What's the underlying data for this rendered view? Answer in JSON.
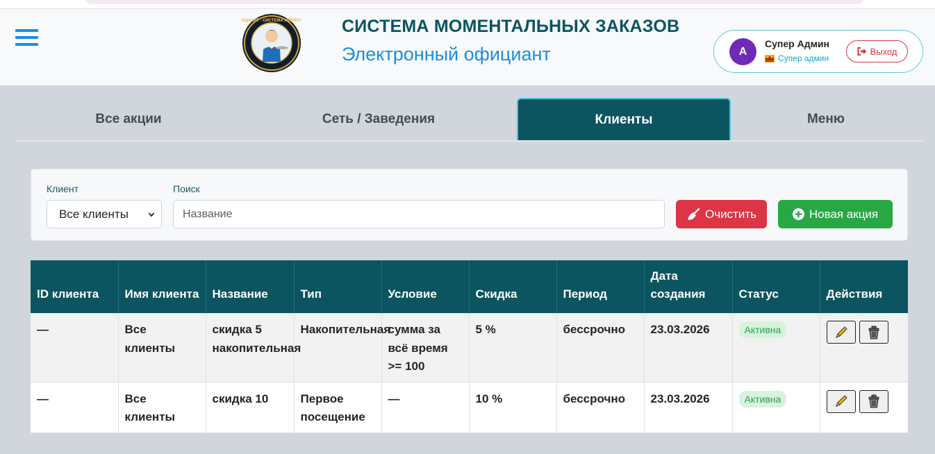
{
  "colors": {
    "primary": "#0b5460",
    "accent": "#1b8ee0",
    "danger": "#dc3545",
    "success": "#27a844",
    "avatar": "#6f2bb8"
  },
  "header": {
    "menu_icon": "hamburger-icon",
    "logo_icon": "waiter-logo",
    "logo_text": "ЭЛЕКТРОННЫЙ ОФИЦИАНТ · СИСТЕМА МОМЕНТАЛЬНЫХ ЗАКАЗОВ",
    "title": "СИСТЕМА МОМЕНТАЛЬНЫХ ЗАКАЗОВ",
    "subtitle": "Электронный официант"
  },
  "user": {
    "avatar_letter": "A",
    "name": "Супер Админ",
    "role_icon": "crown-icon",
    "role": "Супер админ",
    "logout_icon": "sign-out-icon",
    "logout_label": "Выход"
  },
  "tabs": [
    {
      "label": "Все акции",
      "active": false
    },
    {
      "label": "Сеть / Заведения",
      "active": false
    },
    {
      "label": "Клиенты",
      "active": true
    },
    {
      "label": "Меню",
      "active": false
    }
  ],
  "filters": {
    "client_label": "Клиент",
    "client_value": "Все клиенты",
    "search_label": "Поиск",
    "search_placeholder": "Название",
    "clear_icon": "broom-icon",
    "clear_label": "Очистить",
    "new_icon": "plus-circle-icon",
    "new_label": "Новая акция"
  },
  "table": {
    "columns": [
      "ID клиента",
      "Имя клиента",
      "Название",
      "Тип",
      "Условие",
      "Скидка",
      "Период",
      "Дата создания",
      "Статус",
      "Действия"
    ],
    "rows": [
      {
        "id": "—",
        "client": "Все клиенты",
        "name": "скидка 5 накопительная",
        "type": "Накопительная",
        "condition": "сумма за всё время >= 100",
        "discount": "5 %",
        "period": "бессрочно",
        "created": "23.03.2026",
        "status": "Активна"
      },
      {
        "id": "—",
        "client": "Все клиенты",
        "name": "скидка 10",
        "type": "Первое посещение",
        "condition": "—",
        "discount": "10 %",
        "period": "бессрочно",
        "created": "23.03.2026",
        "status": "Активна"
      }
    ],
    "edit_icon": "pencil-icon",
    "delete_icon": "trash-icon"
  }
}
